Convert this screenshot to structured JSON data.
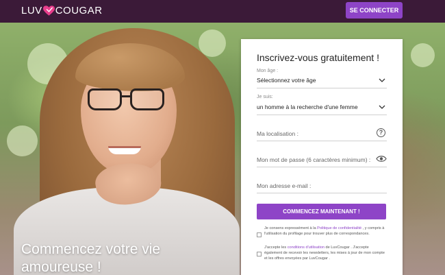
{
  "header": {
    "logo_left": "LUV",
    "logo_right": "COUGAR",
    "login_button": "SE CONNECTER"
  },
  "hero": {
    "headline_line1": "Commencez votre vie",
    "headline_line2": "amoureuse !"
  },
  "form": {
    "title": "Inscrivez-vous gratuitement !",
    "age": {
      "label": "Mon âge :",
      "value": "Sélectionnez votre âge"
    },
    "iam": {
      "label": "Je suis:",
      "value": "un homme à la recherche d'une femme"
    },
    "location_placeholder": "Ma localisation :",
    "password_placeholder": "Mon mot de passe (6 caractères minimum) :",
    "email_placeholder": "Mon adresse e-mail :",
    "submit": "COMMENCEZ MAINTENANT !",
    "consent1": {
      "before": "Je consens expressément à la ",
      "link": "Politique de confidentialité",
      "after": " , y compris à l'utilisation du profilage pour trouver plus de correspondances."
    },
    "consent2": {
      "before": "J'accepte les ",
      "link": "conditions d'utilisation",
      "after": " de LuvCougar . J'accepte également de recevoir les newsletters, les mises à jour de mon compte et les offres envoyées par LuvCougar ."
    }
  },
  "colors": {
    "header_bg": "#3b1a38",
    "accent": "#8e44c7"
  }
}
